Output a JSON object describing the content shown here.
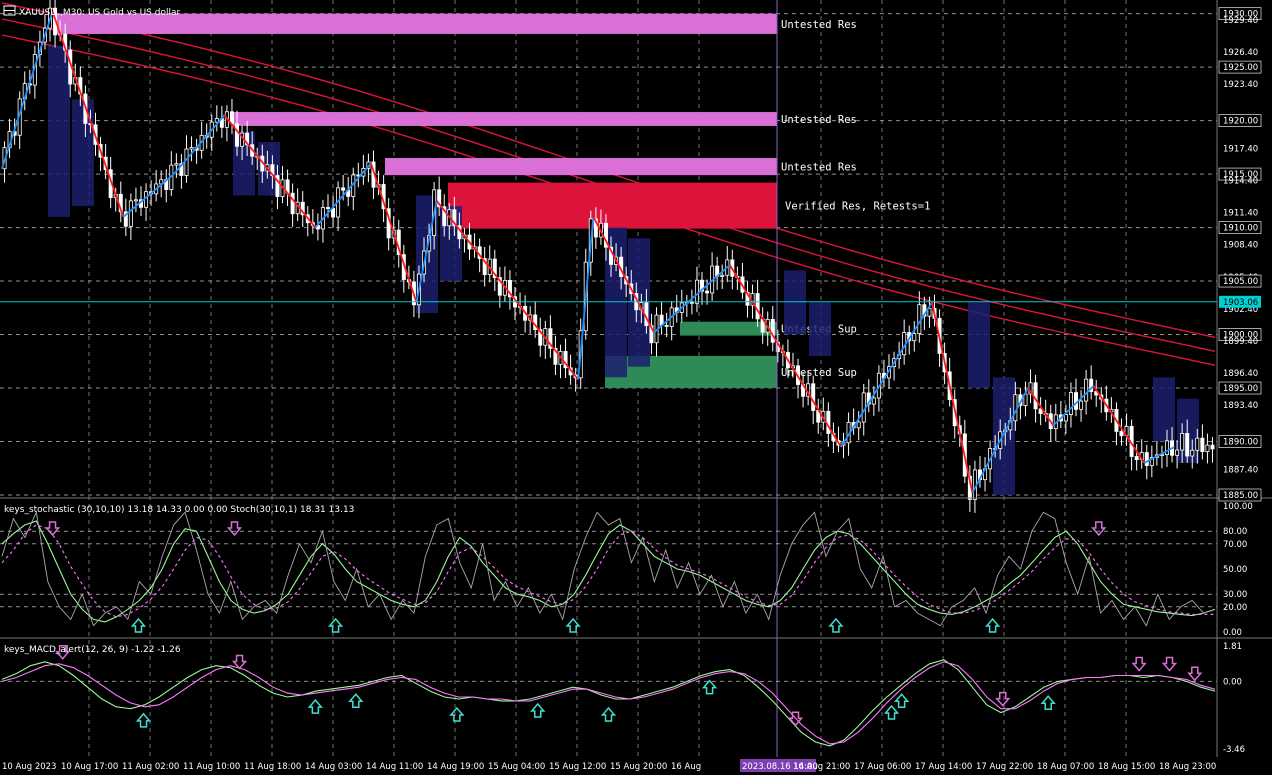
{
  "header": {
    "symbol_line": "XAUUSD.,M30: US Gold vs US dollar"
  },
  "indicators": {
    "stoch_title": "keys_stochastic (30,10,10) 13.18 14.33 0.00 0.00 Stoch(30,10,1) 18.31 13.13",
    "macd_title": "keys_MACD_alert(12, 26, 9) -1.22 -1.26"
  },
  "zones": [
    {
      "label": "Untested Res",
      "price_top": 1930.0,
      "price_bottom": 1928.1,
      "color": "#da70d6"
    },
    {
      "label": "Untested Res",
      "price_top": 1920.8,
      "price_bottom": 1919.5,
      "color": "#da70d6"
    },
    {
      "label": "Untested Res",
      "price_top": 1916.5,
      "price_bottom": 1914.9,
      "color": "#da70d6"
    },
    {
      "label": "Verified Res, Retests=1",
      "price_top": 1914.2,
      "price_bottom": 1909.9,
      "color": "#dc143c"
    },
    {
      "label": "Untested Sup",
      "price_top": 1901.2,
      "price_bottom": 1899.9,
      "color": "#2e8b57"
    },
    {
      "label": "Untested Sup",
      "price_top": 1898.0,
      "price_bottom": 1895.0,
      "color": "#2e8b57"
    }
  ],
  "current_price": "1903.06",
  "cursor_time": "2023.08.16 14:00",
  "colors": {
    "zigzag_up": "#1e90ff",
    "zigzag_down": "#ff1a1a",
    "ma": "#dc143c",
    "price_line": "#00ced1",
    "stoch_main": "#98fb98",
    "stoch_signal": "#ff77ff",
    "stoch_raw": "#a9a9a9",
    "macd_main": "#98fb98",
    "macd_signal": "#ff77ff",
    "arrow_down": "#da70d6",
    "arrow_up": "#40e0d0"
  },
  "chart_data": [
    {
      "type": "candlestick",
      "title": "XAUUSD.,M30: US Gold vs US dollar",
      "ylim": [
        1885.0,
        1930.9
      ],
      "y_ticks": [
        "1930.00",
        "1929.40",
        "1926.40",
        "1925.00",
        "1923.40",
        "1920.00",
        "1917.40",
        "1915.00",
        "1914.40",
        "1911.40",
        "1910.00",
        "1908.40",
        "1905.40",
        "1905.00",
        "1902.40",
        "1900.00",
        "1899.40",
        "1896.40",
        "1895.00",
        "1893.40",
        "1890.00",
        "1887.40",
        "1885.00"
      ],
      "x_ticks": [
        "10 Aug 2023",
        "10 Aug 17:00",
        "11 Aug 02:00",
        "11 Aug 10:00",
        "11 Aug 18:00",
        "14 Aug 03:00",
        "14 Aug 11:00",
        "14 Aug 19:00",
        "15 Aug 04:00",
        "15 Aug 12:00",
        "15 Aug 20:00",
        "16 Aug",
        "2023.08.16 14:00",
        "16 Aug 21:00",
        "17 Aug 06:00",
        "17 Aug 14:00",
        "17 Aug 22:00",
        "18 Aug 07:00",
        "18 Aug 15:00",
        "18 Aug 23:00"
      ],
      "zigzag": [
        {
          "t": 0,
          "price": 1915.5
        },
        {
          "t": 10,
          "price": 1930.2
        },
        {
          "t": 24,
          "price": 1911.0
        },
        {
          "t": 34,
          "price": 1915.0
        },
        {
          "t": 44,
          "price": 1920.5
        },
        {
          "t": 62,
          "price": 1910.0
        },
        {
          "t": 73,
          "price": 1916.0
        },
        {
          "t": 82,
          "price": 1903.0
        },
        {
          "t": 86,
          "price": 1912.5
        },
        {
          "t": 114,
          "price": 1895.8
        },
        {
          "t": 117,
          "price": 1911.0
        },
        {
          "t": 129,
          "price": 1900.2
        },
        {
          "t": 144,
          "price": 1906.5
        },
        {
          "t": 166,
          "price": 1889.5
        },
        {
          "t": 184,
          "price": 1903.0
        },
        {
          "t": 192,
          "price": 1885.2
        },
        {
          "t": 203,
          "price": 1895.0
        },
        {
          "t": 208,
          "price": 1891.5
        },
        {
          "t": 216,
          "price": 1895.2
        },
        {
          "t": 226,
          "price": 1888.0
        },
        {
          "t": 232,
          "price": 1889.5
        }
      ],
      "moving_averages": [
        {
          "name": "",
          "start": 1931.0,
          "end": 1899.5
        },
        {
          "name": "",
          "start": 1929.5,
          "end": 1898.2
        },
        {
          "name": "",
          "start": 1928.0,
          "end": 1896.9
        }
      ]
    },
    {
      "type": "line",
      "title": "keys_stochastic (30,10,10) 13.18 14.33 0.00 0.00 Stoch(30,10,1) 18.31 13.13",
      "ylim": [
        0,
        100
      ],
      "y_ticks": [
        "100.00",
        "80.00",
        "70.00",
        "50.00",
        "30.00",
        "20.00",
        "0.00"
      ],
      "levels": [
        80,
        70,
        30,
        20
      ],
      "series": [
        {
          "name": "",
          "values": [
            70,
            78,
            85,
            88,
            70,
            50,
            30,
            18,
            10,
            8,
            12,
            18,
            25,
            35,
            50,
            70,
            82,
            80,
            60,
            40,
            25,
            18,
            15,
            17,
            22,
            30,
            45,
            60,
            70,
            62,
            50,
            40,
            35,
            30,
            25,
            22,
            20,
            25,
            40,
            60,
            75,
            68,
            55,
            45,
            35,
            30,
            28,
            25,
            20,
            22,
            30,
            45,
            62,
            78,
            85,
            80,
            70,
            60,
            55,
            50,
            48,
            45,
            40,
            35,
            30,
            25,
            22,
            20,
            25,
            35,
            50,
            65,
            75,
            80,
            78,
            70,
            60,
            50,
            40,
            30,
            22,
            18,
            15,
            14,
            16,
            20,
            25,
            30,
            38,
            45,
            55,
            65,
            75,
            80,
            70,
            55,
            40,
            30,
            22,
            20,
            18,
            16,
            15,
            14,
            13,
            15,
            18
          ]
        },
        {
          "name": "",
          "values": [
            55,
            65,
            78,
            85,
            82,
            70,
            52,
            38,
            25,
            16,
            12,
            14,
            19,
            26,
            36,
            50,
            65,
            75,
            73,
            60,
            44,
            30,
            22,
            18,
            19,
            24,
            34,
            47,
            60,
            64,
            58,
            49,
            42,
            36,
            30,
            26,
            22,
            23,
            32,
            48,
            63,
            67,
            60,
            51,
            42,
            36,
            32,
            28,
            24,
            22,
            26,
            36,
            50,
            66,
            77,
            80,
            75,
            66,
            59,
            53,
            50,
            47,
            43,
            38,
            33,
            28,
            24,
            21,
            22,
            29,
            41,
            55,
            67,
            75,
            77,
            73,
            65,
            55,
            45,
            36,
            28,
            22,
            18,
            15,
            15,
            17,
            21,
            26,
            33,
            40,
            48,
            58,
            67,
            74,
            73,
            63,
            50,
            39,
            30,
            24,
            21,
            18,
            16,
            15,
            14,
            14,
            14
          ]
        },
        {
          "name": "",
          "values": [
            60,
            90,
            75,
            95,
            40,
            20,
            10,
            30,
            5,
            15,
            20,
            10,
            40,
            30,
            60,
            85,
            95,
            65,
            30,
            15,
            40,
            10,
            20,
            25,
            15,
            45,
            70,
            55,
            80,
            40,
            25,
            50,
            20,
            30,
            10,
            25,
            15,
            60,
            85,
            90,
            55,
            35,
            70,
            25,
            40,
            20,
            35,
            15,
            30,
            10,
            50,
            75,
            95,
            85,
            90,
            55,
            75,
            40,
            65,
            35,
            55,
            30,
            45,
            20,
            40,
            15,
            30,
            10,
            45,
            70,
            85,
            95,
            60,
            80,
            90,
            50,
            35,
            60,
            20,
            25,
            15,
            10,
            5,
            20,
            25,
            35,
            15,
            45,
            60,
            50,
            80,
            95,
            90,
            55,
            30,
            60,
            15,
            25,
            10,
            20,
            5,
            30,
            10,
            20,
            25,
            15,
            18
          ]
        }
      ],
      "signals": [
        {
          "t": 10,
          "dir": "down"
        },
        {
          "t": 27,
          "dir": "up"
        },
        {
          "t": 46,
          "dir": "down"
        },
        {
          "t": 66,
          "dir": "up"
        },
        {
          "t": 113,
          "dir": "up"
        },
        {
          "t": 165,
          "dir": "up"
        },
        {
          "t": 196,
          "dir": "up"
        },
        {
          "t": 217,
          "dir": "down"
        }
      ]
    },
    {
      "type": "line",
      "title": "keys_MACD_alert(12, 26, 9) -1.22 -1.26",
      "ylim": [
        -3.46,
        1.81
      ],
      "y_ticks": [
        "1.81",
        "0.00",
        "-3.46"
      ],
      "series": [
        {
          "name": "",
          "values": [
            0.1,
            0.4,
            0.8,
            1.0,
            0.8,
            0.3,
            -0.3,
            -0.9,
            -1.3,
            -1.4,
            -1.2,
            -0.8,
            -0.3,
            0.2,
            0.6,
            0.8,
            0.7,
            0.3,
            -0.2,
            -0.6,
            -0.8,
            -0.7,
            -0.5,
            -0.4,
            -0.3,
            -0.2,
            0.0,
            0.2,
            0.3,
            -0.1,
            -0.5,
            -0.8,
            -0.9,
            -0.8,
            -0.9,
            -1.0,
            -1.0,
            -0.9,
            -0.7,
            -0.5,
            -0.3,
            -0.4,
            -0.7,
            -0.9,
            -0.9,
            -0.7,
            -0.5,
            -0.3,
            0.0,
            0.3,
            0.5,
            0.6,
            0.3,
            -0.3,
            -1.0,
            -1.8,
            -2.6,
            -3.1,
            -3.3,
            -3.0,
            -2.3,
            -1.5,
            -0.8,
            -0.2,
            0.4,
            0.9,
            1.1,
            0.6,
            -0.3,
            -1.2,
            -1.6,
            -1.3,
            -0.8,
            -0.3,
            0.0,
            0.1,
            0.2,
            0.2,
            0.3,
            0.3,
            0.2,
            0.3,
            0.2,
            0.0,
            -0.3,
            -0.5
          ]
        },
        {
          "name": "",
          "values": [
            0.0,
            0.2,
            0.5,
            0.8,
            0.9,
            0.7,
            0.3,
            -0.2,
            -0.7,
            -1.1,
            -1.3,
            -1.2,
            -0.8,
            -0.3,
            0.2,
            0.6,
            0.8,
            0.6,
            0.2,
            -0.3,
            -0.6,
            -0.7,
            -0.6,
            -0.5,
            -0.4,
            -0.3,
            -0.1,
            0.1,
            0.2,
            0.1,
            -0.3,
            -0.6,
            -0.8,
            -0.8,
            -0.9,
            -0.9,
            -1.0,
            -1.0,
            -0.8,
            -0.6,
            -0.4,
            -0.4,
            -0.6,
            -0.8,
            -0.9,
            -0.8,
            -0.6,
            -0.4,
            -0.1,
            0.2,
            0.4,
            0.5,
            0.4,
            0.0,
            -0.6,
            -1.4,
            -2.2,
            -2.8,
            -3.2,
            -3.1,
            -2.6,
            -1.9,
            -1.1,
            -0.4,
            0.2,
            0.7,
            1.0,
            0.8,
            0.1,
            -0.8,
            -1.4,
            -1.4,
            -1.0,
            -0.5,
            -0.1,
            0.1,
            0.2,
            0.2,
            0.3,
            0.3,
            0.3,
            0.3,
            0.2,
            0.1,
            -0.2,
            -0.4
          ]
        }
      ],
      "signals": [
        {
          "t": 12,
          "dir": "down"
        },
        {
          "t": 28,
          "dir": "up"
        },
        {
          "t": 47,
          "dir": "down"
        },
        {
          "t": 62,
          "dir": "up"
        },
        {
          "t": 70,
          "dir": "up"
        },
        {
          "t": 90,
          "dir": "up"
        },
        {
          "t": 106,
          "dir": "up"
        },
        {
          "t": 120,
          "dir": "up"
        },
        {
          "t": 140,
          "dir": "up"
        },
        {
          "t": 157,
          "dir": "down"
        },
        {
          "t": 176,
          "dir": "up"
        },
        {
          "t": 178,
          "dir": "up"
        },
        {
          "t": 198,
          "dir": "down"
        },
        {
          "t": 207,
          "dir": "up"
        },
        {
          "t": 225,
          "dir": "down"
        },
        {
          "t": 231,
          "dir": "down"
        },
        {
          "t": 236,
          "dir": "down"
        }
      ]
    }
  ]
}
